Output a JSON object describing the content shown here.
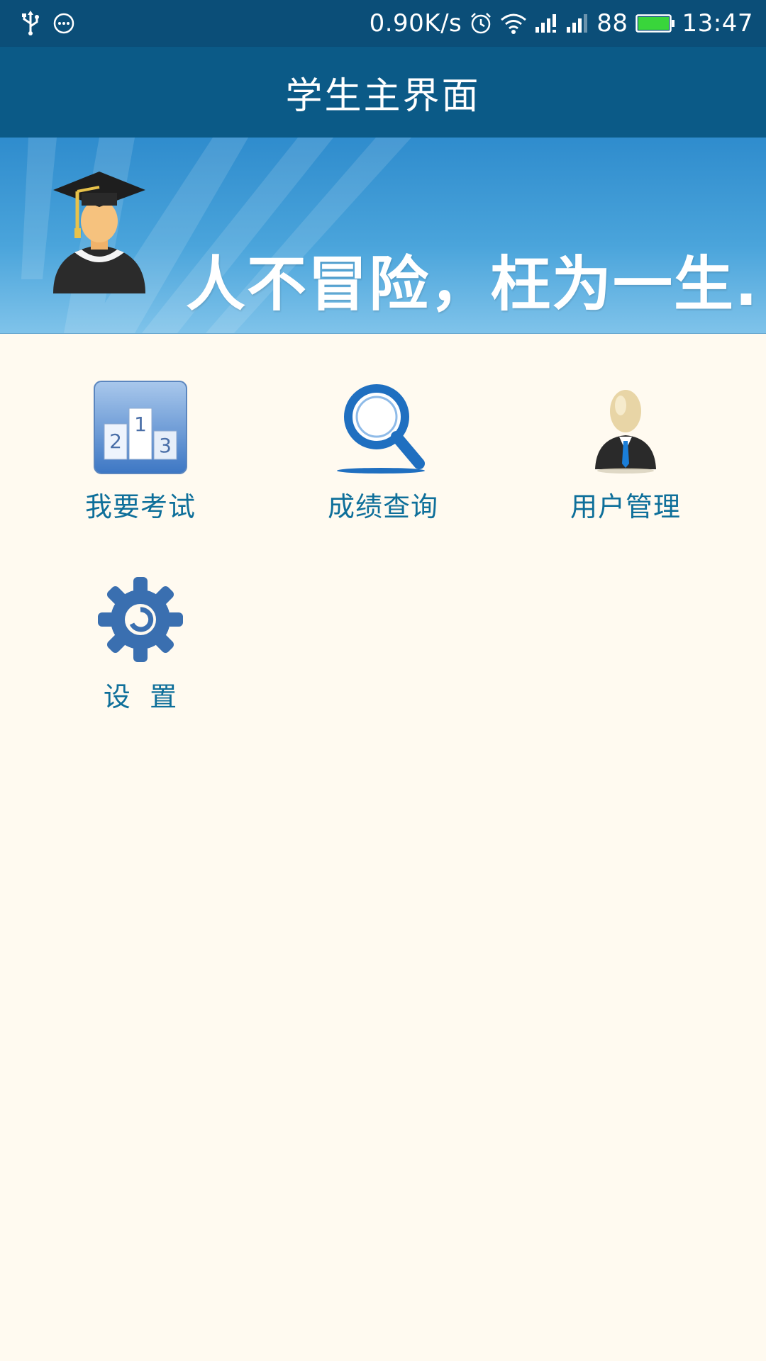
{
  "status_bar": {
    "network_speed": "0.90K/s",
    "battery": "88",
    "time": "13:47",
    "icons": [
      "usb-icon",
      "more-icon",
      "alarm-icon",
      "wifi-icon",
      "signal-icon",
      "signal-2-icon",
      "battery-icon"
    ],
    "battery_color": "#39d53b"
  },
  "title_bar": {
    "title": "学生主界面"
  },
  "banner": {
    "slogan": "人不冒险，枉为一生."
  },
  "menu": {
    "items": [
      {
        "label": "我要考试",
        "icon": "podium-icon"
      },
      {
        "label": "成绩查询",
        "icon": "magnifier-icon"
      },
      {
        "label": "用户管理",
        "icon": "user-icon"
      },
      {
        "label": "设  置",
        "icon": "gear-icon"
      }
    ]
  },
  "colors": {
    "status_bar": "#0b4e78",
    "title_bar": "#0b5a87",
    "page_background": "#fffaf0",
    "menu_label": "#0e6f9a"
  }
}
